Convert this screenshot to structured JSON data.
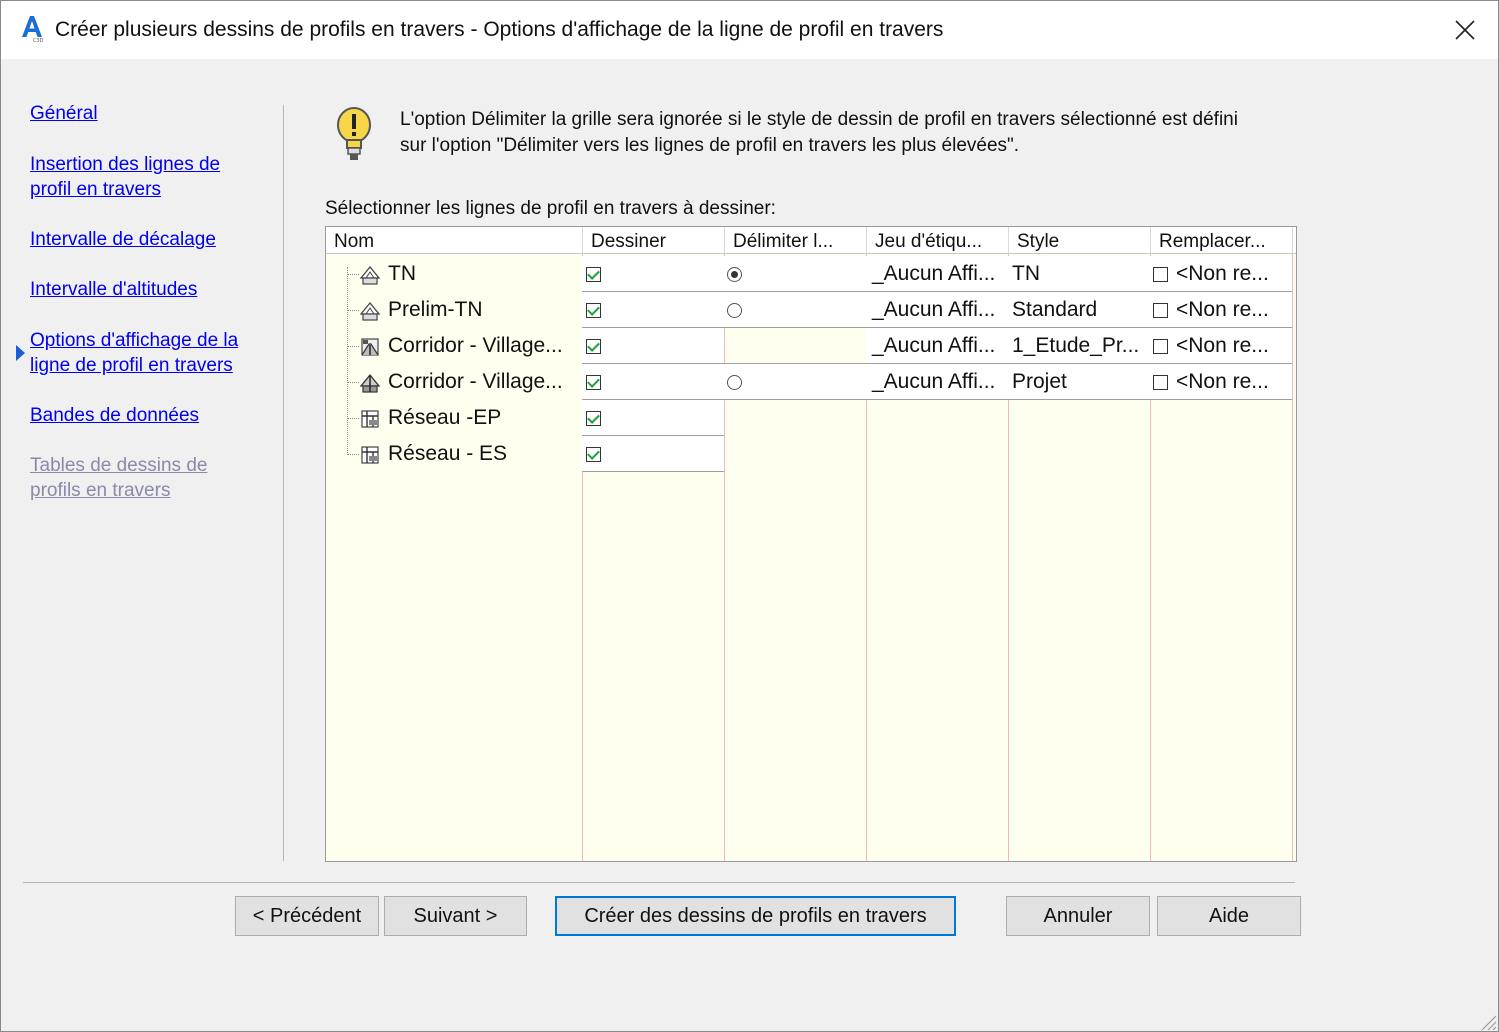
{
  "window": {
    "title": "Créer plusieurs dessins de profils en travers - Options d'affichage de la ligne de profil en travers"
  },
  "nav": {
    "items": [
      {
        "label": "Général",
        "active": false,
        "enabled": true
      },
      {
        "label": "Insertion des lignes de profil en travers",
        "line1": "Insertion des lignes de ",
        "line2": "profil en travers",
        "active": false,
        "enabled": true
      },
      {
        "label": "Intervalle de décalage",
        "active": false,
        "enabled": true
      },
      {
        "label": "Intervalle d'altitudes",
        "active": false,
        "enabled": true
      },
      {
        "label": "Options d'affichage de la ligne de profil en travers",
        "line1": "Options d'affichage de la ",
        "line2": "ligne de profil en travers",
        "active": true,
        "enabled": true
      },
      {
        "label": "Bandes de données",
        "active": false,
        "enabled": true
      },
      {
        "label": "Tables de dessins de profils en travers",
        "line1": "Tables de dessins de ",
        "line2": "profils en travers",
        "active": false,
        "enabled": false
      }
    ]
  },
  "info": {
    "line1": "L'option Délimiter la grille sera ignorée si le style de dessin de profil en travers sélectionné est défini",
    "line2": "sur l'option \"Délimiter vers les lignes de profil en travers les plus élevées\"."
  },
  "grid": {
    "label": "Sélectionner les lignes de profil en travers à dessiner:",
    "columns": [
      "Nom",
      "Dessiner",
      "Délimiter l...",
      "Jeu d'étiqu...",
      "Style",
      "Remplacer..."
    ],
    "rows": [
      {
        "name": "TN",
        "icon": "surface-icon",
        "draw": true,
        "clip": "selected",
        "label_set": "_Aucun Affi...",
        "style": "TN",
        "override_checked": false,
        "override": "<Non re..."
      },
      {
        "name": "Prelim-TN",
        "icon": "surface-icon",
        "draw": true,
        "clip": "unselected",
        "label_set": "_Aucun Affi...",
        "style": "Standard",
        "override_checked": false,
        "override": "<Non re..."
      },
      {
        "name": "Corridor - Village...",
        "icon": "corridor-icon",
        "draw": true,
        "clip": "none",
        "label_set": "_Aucun Affi...",
        "style": "1_Etude_Pr...",
        "override_checked": false,
        "override": "<Non re..."
      },
      {
        "name": "Corridor - Village...",
        "icon": "corridor-surface-icon",
        "draw": true,
        "clip": "unselected",
        "label_set": "_Aucun Affi...",
        "style": "Projet",
        "override_checked": false,
        "override": "<Non re..."
      },
      {
        "name": "Réseau -EP",
        "icon": "pipe-network-icon",
        "draw": true,
        "clip": "none",
        "label_set": "",
        "style": "",
        "override": ""
      },
      {
        "name": "Réseau - ES",
        "icon": "pipe-network-icon",
        "draw": true,
        "clip": "none",
        "label_set": "",
        "style": "",
        "override": ""
      }
    ]
  },
  "buttons": {
    "previous": "< Précédent",
    "next": "Suivant >",
    "create": "Créer des dessins de profils en travers",
    "cancel": "Annuler",
    "help": "Aide"
  },
  "colors": {
    "grid_background": "#fffff0",
    "link": "#0000ee",
    "accent": "#0078d7"
  }
}
